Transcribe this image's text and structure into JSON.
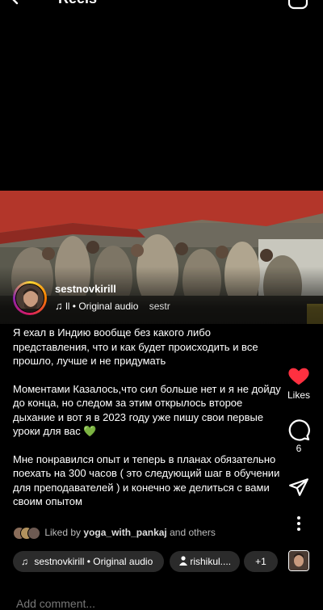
{
  "header": {
    "title": "Reels",
    "back_icon": "back-arrow-icon",
    "camera_icon": "camera-icon"
  },
  "post": {
    "username": "sestnovkirill",
    "audio": {
      "icon": "music-note-icon",
      "bars": "ll",
      "label": "Original audio",
      "scroll_text": "sestr"
    },
    "caption": [
      "Я ехал в Индию вообще без какого либо представления, что и как будет происходить и все прошло, лучше и не придумать",
      "Моментами Казалось,что сил больше нет и я не дойду до конца, но следом за этим открылось второе дыхание и вот я в 2023 году уже пишу свои первые уроки для вас 💚",
      "Мне понравился опыт и теперь в планах обязательно поехать на 300 часов ( это следующий шаг в обучении для преподавателей ) и конечно же делиться с вами своим опытом"
    ]
  },
  "actions": {
    "likes_label": "Likes",
    "comments_count": "6"
  },
  "liked_by": {
    "prefix": "Liked by",
    "user": "yoga_with_pankaj",
    "suffix": "and others"
  },
  "chips": {
    "audio": "sestnovkirill • Original audio",
    "user": "rishikul....",
    "more": "+1"
  },
  "comment_box": {
    "placeholder": "Add comment..."
  },
  "colors": {
    "background": "#000000",
    "like": "#ff3040",
    "chip_bg": "#2b2b2b",
    "muted_text": "#bbbbbb"
  }
}
